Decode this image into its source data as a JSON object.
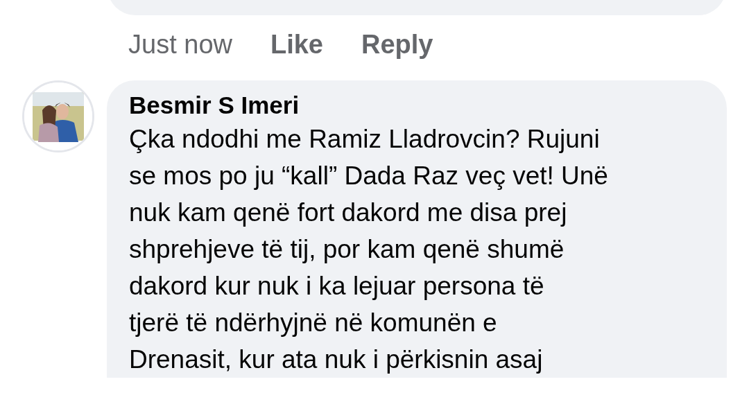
{
  "previous_comment": {
    "actions": [
      {
        "kind": "time",
        "label": "Just now"
      },
      {
        "kind": "action",
        "label": "Like"
      },
      {
        "kind": "action",
        "label": "Reply"
      }
    ]
  },
  "comment": {
    "author": "Besmir S Imeri",
    "lines": [
      "Çka ndodhi me Ramiz Lladrovcin? Rujuni",
      "se mos po ju “kall” Dada Raz veç vet! Unë",
      "nuk kam qenë fort dakord me disa prej",
      "shprehjeve të tij, por kam qenë shumë",
      "dakord kur nuk i ka lejuar persona të",
      "tjerë të ndërhyjnë në komunën e",
      "Drenasit, kur ata nuk i përkisnin asaj"
    ]
  }
}
